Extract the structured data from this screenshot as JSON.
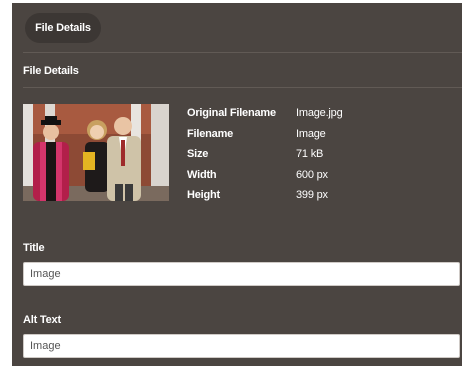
{
  "tab": {
    "label": "File Details"
  },
  "section": {
    "title": "File Details"
  },
  "details": [
    {
      "label": "Original Filename",
      "value": "Image.jpg"
    },
    {
      "label": "Filename",
      "value": "Image"
    },
    {
      "label": "Size",
      "value": "71 kB"
    },
    {
      "label": "Width",
      "value": "600 px"
    },
    {
      "label": "Height",
      "value": "399 px"
    }
  ],
  "fields": {
    "title": {
      "label": "Title",
      "value": "Image"
    },
    "alt_text": {
      "label": "Alt Text",
      "value": "Image"
    }
  },
  "colors": {
    "panel_bg": "#4b4541",
    "tab_bg": "#3c3734",
    "divider": "#615a55"
  }
}
